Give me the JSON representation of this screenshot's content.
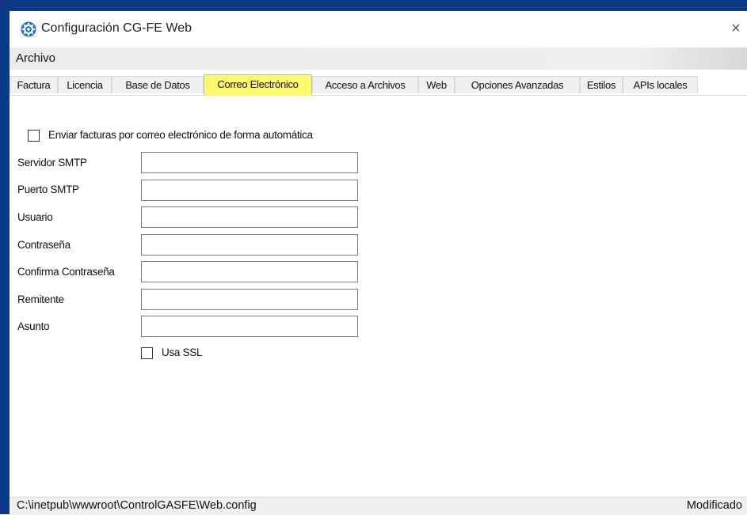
{
  "window": {
    "title": "Configuración CG-FE Web",
    "close_glyph": "×"
  },
  "menu": {
    "archivo": "Archivo"
  },
  "tabs": [
    {
      "label": "Factura"
    },
    {
      "label": "Licencia"
    },
    {
      "label": "Base de Datos"
    },
    {
      "label": "Correo Electrónico",
      "active": true
    },
    {
      "label": "Acceso a Archivos"
    },
    {
      "label": "Web"
    },
    {
      "label": "Opciones Avanzadas"
    },
    {
      "label": "Estilos"
    },
    {
      "label": "APIs locales"
    }
  ],
  "form": {
    "auto_send_label": "Enviar facturas por correo electrónico de forma automática",
    "auto_send_checked": false,
    "fields": [
      {
        "label": "Servidor SMTP",
        "value": ""
      },
      {
        "label": "Puerto SMTP",
        "value": ""
      },
      {
        "label": "Usuario",
        "value": ""
      },
      {
        "label": "Contraseña",
        "value": ""
      },
      {
        "label": "Confirma Contraseña",
        "value": ""
      },
      {
        "label": "Remitente",
        "value": ""
      },
      {
        "label": "Asunto",
        "value": ""
      }
    ],
    "ssl_label": "Usa SSL",
    "ssl_checked": false
  },
  "status": {
    "path": "C:\\inetpub\\wwwroot\\ControlGASFE\\Web.config",
    "state": "Modificado"
  },
  "colors": {
    "active_tab": "#fff86a",
    "desktop_frame": "#0d3a88",
    "app_icon": "#1a73c8"
  },
  "icons": {
    "app": "gear-icon",
    "close": "close-icon"
  }
}
